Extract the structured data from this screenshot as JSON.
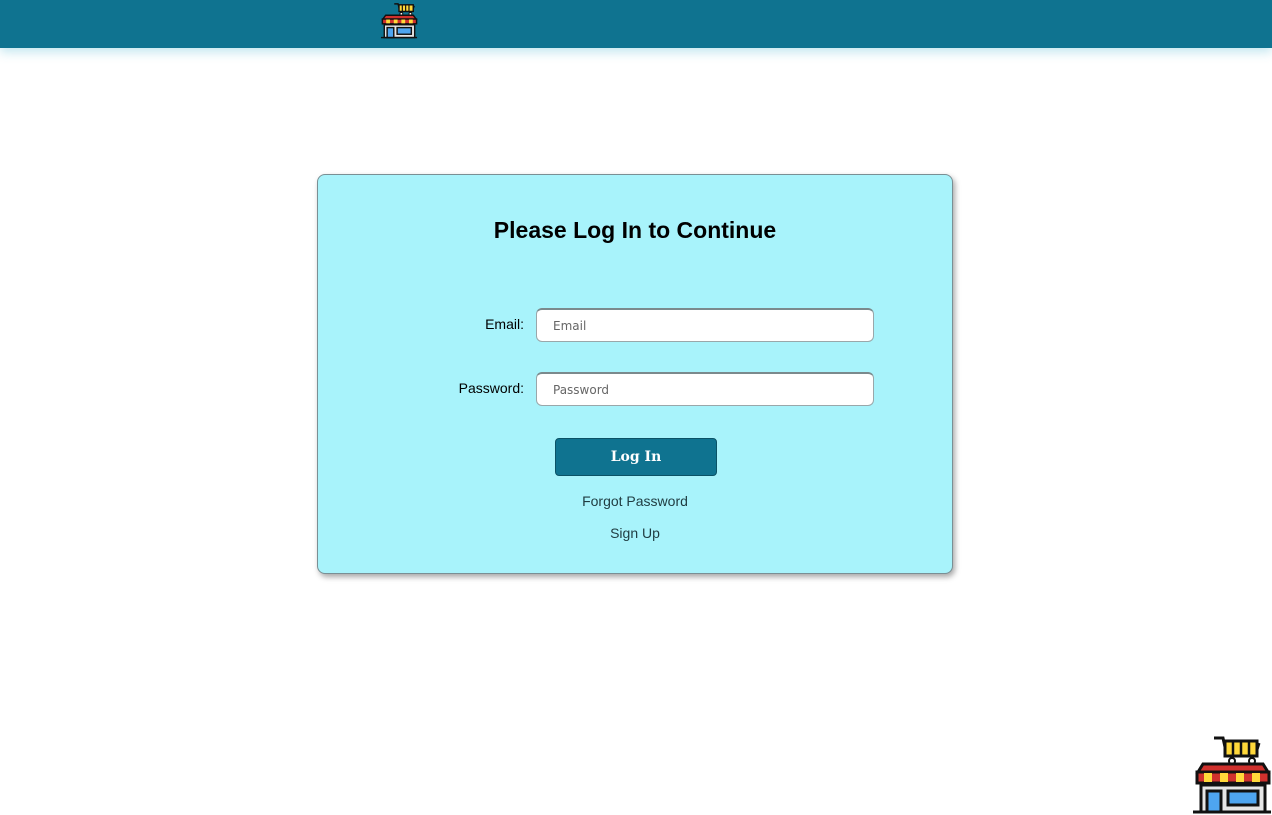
{
  "header": {
    "logo_icon": "shop-cart-icon",
    "bar_color": "#0f7390"
  },
  "login": {
    "title": "Please Log In to Continue",
    "email_label": "Email:",
    "email_placeholder": "Email",
    "email_value": "",
    "password_label": "Password:",
    "password_placeholder": "Password",
    "password_value": "",
    "submit_label": "Log In",
    "forgot_password": "Forgot Password",
    "sign_up": "Sign Up",
    "card_color": "#a8f3fb",
    "button_color": "#0f7390"
  },
  "footer": {
    "corner_icon": "shop-cart-icon"
  }
}
